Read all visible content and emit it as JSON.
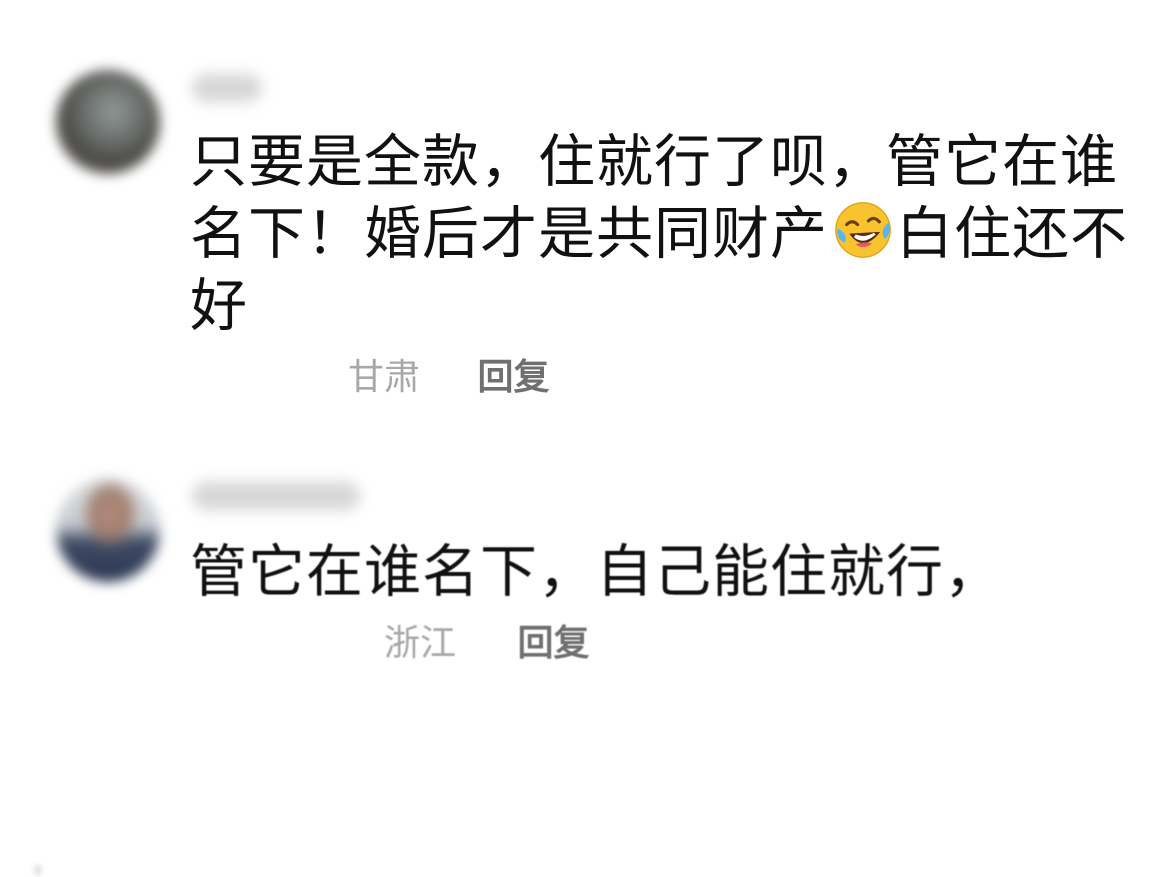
{
  "comments": [
    {
      "text_before_emoji": "只要是全款，住就行了呗，管它在谁名下！婚后才是共同财产",
      "emoji": "laughing-crying-emoji",
      "text_after_emoji": "白住还不好",
      "region": "甘肃",
      "reply_label": "回复"
    },
    {
      "text": "管它在谁名下，自己能住就行，",
      "region": "浙江",
      "reply_label": "回复"
    }
  ],
  "colors": {
    "text": "#111111",
    "region": "#a8a8a8",
    "reply": "#707070",
    "background": "#ffffff",
    "emoji_face": "#f7c32e"
  }
}
